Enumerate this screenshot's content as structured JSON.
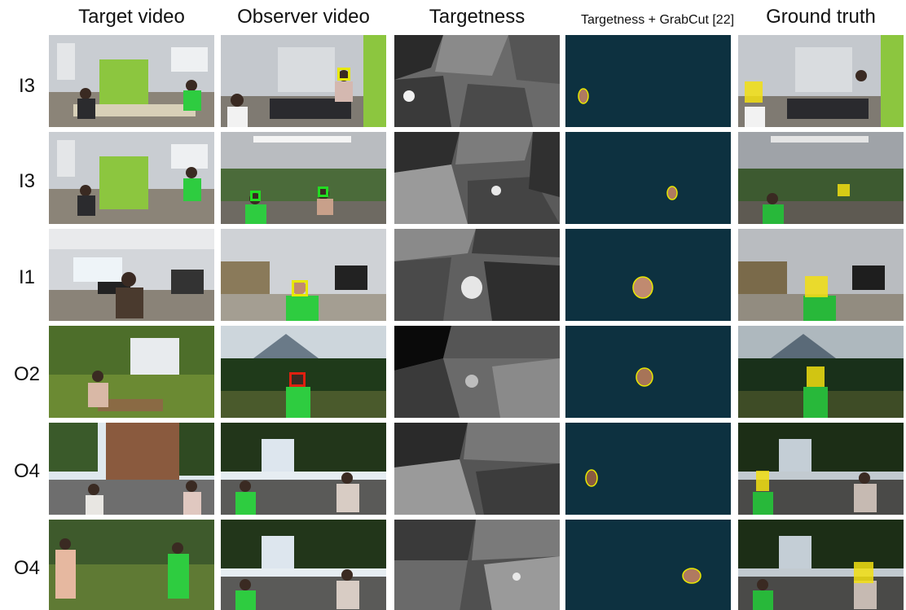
{
  "headers": {
    "target_video": "Target video",
    "observer_video": "Observer video",
    "targetness": "Targetness",
    "targetness_grabcut": "Targetness + GrabCut [22]",
    "ground_truth": "Ground truth"
  },
  "rows": [
    {
      "label": "I3"
    },
    {
      "label": "I3"
    },
    {
      "label": "I1"
    },
    {
      "label": "O2"
    },
    {
      "label": "O4"
    },
    {
      "label": "O4"
    }
  ],
  "colors": {
    "grabcut_bg": "#0d3140",
    "box_yellow": "#e8e800",
    "box_green": "#22dd22",
    "box_red": "#e02010",
    "gt_highlight": "#f2df12"
  }
}
